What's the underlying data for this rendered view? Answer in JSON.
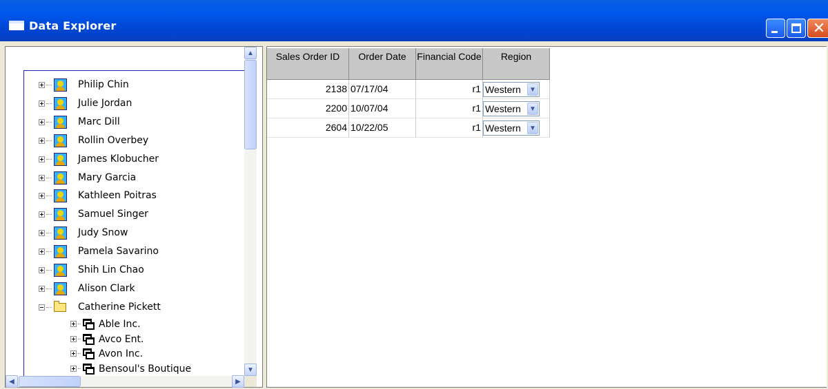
{
  "window": {
    "title": "Data Explorer"
  },
  "tree": {
    "people": [
      {
        "name": "Philip  Chin"
      },
      {
        "name": "Julie  Jordan"
      },
      {
        "name": "Marc  Dill"
      },
      {
        "name": "Rollin  Overbey"
      },
      {
        "name": "James  Klobucher"
      },
      {
        "name": "Mary  Garcia"
      },
      {
        "name": "Kathleen  Poitras"
      },
      {
        "name": "Samuel  Singer"
      },
      {
        "name": "Judy  Snow"
      },
      {
        "name": "Pamela  Savarino"
      },
      {
        "name": "Shih Lin  Chao"
      },
      {
        "name": "Alison  Clark"
      }
    ],
    "expanded": {
      "name": "Catherine  Pickett",
      "companies": [
        {
          "name": "Able Inc."
        },
        {
          "name": "Avco Ent."
        },
        {
          "name": "Avon Inc."
        },
        {
          "name": "Bensoul's Boutique"
        }
      ]
    }
  },
  "grid": {
    "columns": [
      {
        "label": "Sales Order ID"
      },
      {
        "label": "Order Date"
      },
      {
        "label": "Financial Code"
      },
      {
        "label": "Region"
      }
    ],
    "rows": [
      {
        "id": "2138",
        "date": "07/17/04",
        "code": "r1",
        "region": "Western"
      },
      {
        "id": "2200",
        "date": "10/07/04",
        "code": "r1",
        "region": "Western"
      },
      {
        "id": "2604",
        "date": "10/22/05",
        "code": "r1",
        "region": "Western"
      }
    ]
  },
  "icons": {
    "person": "person-icon",
    "folder": "open-folder-icon",
    "company": "company-icon",
    "colors": {
      "titlebar": "#0058ee",
      "grid_header": "#c8c8c8",
      "tree_border": "#2020b0"
    }
  }
}
